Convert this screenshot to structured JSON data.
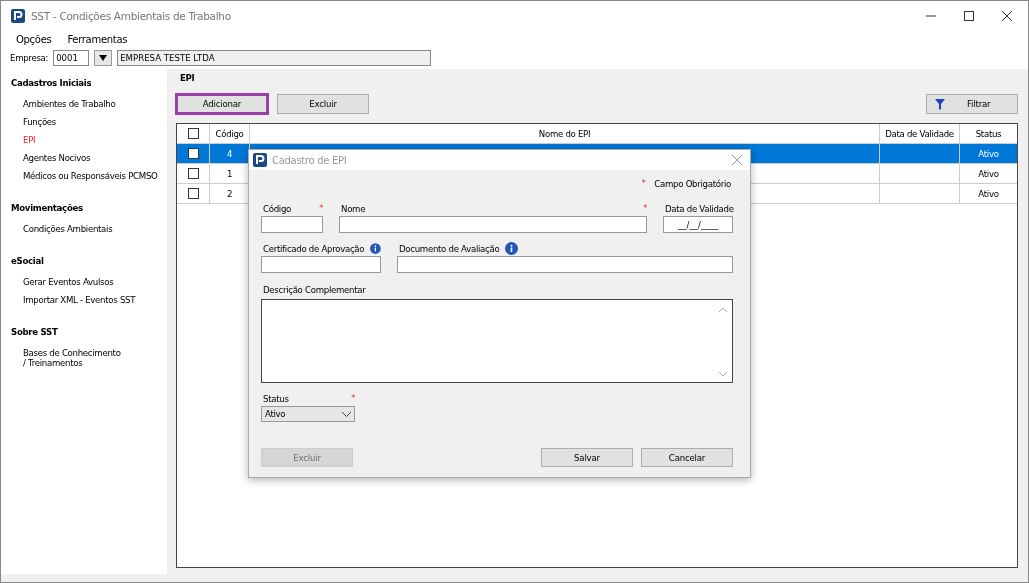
{
  "window": {
    "title": "SST - Condições Ambientais de Trabalho"
  },
  "menu": [
    "Opções",
    "Ferramentas"
  ],
  "company": {
    "label": "Empresa:",
    "code": "0001",
    "name": "EMPRESA TESTE LTDA"
  },
  "sidebar": [
    {
      "title": "Cadastros Iniciais",
      "items": [
        {
          "label": "Ambientes de Trabalho",
          "selected": false
        },
        {
          "label": "Funções",
          "selected": false
        },
        {
          "label": "EPI",
          "selected": true
        },
        {
          "label": "Agentes Nocivos",
          "selected": false
        },
        {
          "label": "Médicos ou Responsáveis PCMSO",
          "selected": false
        }
      ]
    },
    {
      "title": "Movimentações",
      "items": [
        {
          "label": "Condições Ambientais",
          "selected": false
        }
      ]
    },
    {
      "title": "eSocial",
      "items": [
        {
          "label": "Gerar Eventos Avulsos",
          "selected": false
        },
        {
          "label": "Importar XML - Eventos SST",
          "selected": false
        }
      ]
    },
    {
      "title": "Sobre SST",
      "items": [
        {
          "label": "Bases de Conhecimento / Treinamentos",
          "selected": false
        }
      ]
    }
  ],
  "section_title": "EPI",
  "toolbar": [
    {
      "label": "Adicionar",
      "focused": true
    },
    {
      "label": "Excluir",
      "focused": false
    }
  ],
  "filter_button": "Filtrar",
  "table": {
    "all_checked": false,
    "columns": [
      "Código",
      "Nome do EPI",
      "Data de Validade",
      "Status"
    ],
    "rows": [
      {
        "selected": true,
        "checked": false,
        "code": "4",
        "status": "Ativo"
      },
      {
        "selected": false,
        "checked": false,
        "code": "1",
        "status": "Ativo"
      },
      {
        "selected": false,
        "checked": false,
        "code": "2",
        "status": "Ativo"
      }
    ]
  },
  "dialog": {
    "title": "Cadastro de EPI",
    "required_legend": {
      "mark": "*",
      "label": "Campo Obrigatório"
    },
    "fields": {
      "code": {
        "label": "Código",
        "mark": "*"
      },
      "name": {
        "label": "Nome",
        "mark": "*"
      },
      "valid_date": {
        "label": "Data de Validade",
        "value": "__/__/____"
      },
      "certificate": {
        "label": "Certificado de Aprovação"
      },
      "document": {
        "label": "Documento de Avaliação"
      },
      "description": {
        "label": "Descrição Complementar"
      },
      "status": {
        "label": "Status",
        "mark": "*",
        "value": "Ativo"
      }
    },
    "buttons": [
      {
        "label": "Excluir",
        "disabled": true
      },
      {
        "label": "Salvar",
        "disabled": false
      },
      {
        "label": "Cancelar",
        "disabled": false
      }
    ]
  }
}
